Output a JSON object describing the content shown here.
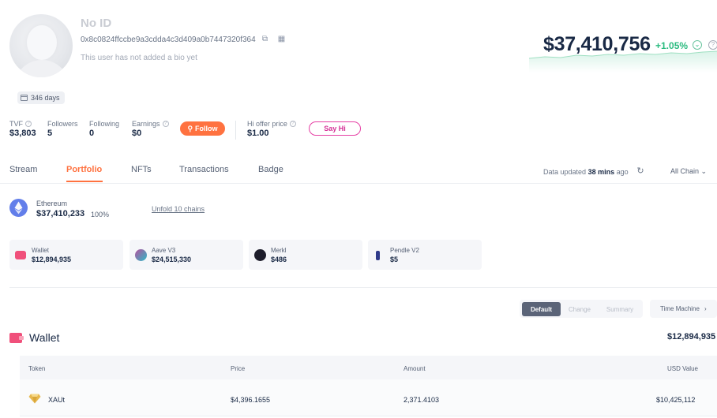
{
  "profile": {
    "name": "No ID",
    "address": "0x8c0824ffccbe9a3cdda4c3d409a0b7447320f364",
    "bio": "This user has not added a bio yet",
    "days": "346 days"
  },
  "net_worth": {
    "value": "$37,410,756",
    "change": "+1.05%",
    "change_chevron": "⌄",
    "help": "?"
  },
  "stats": {
    "tvf_label": "TVF",
    "tvf_value": "$3,803",
    "followers_label": "Followers",
    "followers_value": "5",
    "following_label": "Following",
    "following_value": "0",
    "earnings_label": "Earnings",
    "earnings_value": "$0",
    "follow_button": "Follow",
    "hi_offer_label": "Hi offer price",
    "hi_offer_value": "$1.00",
    "say_hi_button": "Say Hi"
  },
  "tabs": [
    "Stream",
    "Portfolio",
    "NFTs",
    "Transactions",
    "Badge"
  ],
  "active_tab": "Portfolio",
  "toolbar": {
    "data_updated_prefix": "Data updated",
    "data_updated_time": "38 mins",
    "data_updated_suffix": "ago",
    "chain_filter": "All Chain"
  },
  "chain": {
    "name": "Ethereum",
    "value": "$37,410,233",
    "percent": "100%",
    "unfold_link": "Unfold 10 chains"
  },
  "protocols": [
    {
      "name": "Wallet",
      "value": "$12,894,935",
      "icon": "wallet-icon",
      "color": "#f0507b"
    },
    {
      "name": "Aave V3",
      "value": "$24,515,330",
      "icon": "aave-icon",
      "color": "#9b8ee6"
    },
    {
      "name": "Merkl",
      "value": "$486",
      "icon": "merkl-icon",
      "color": "#1d1d2b"
    },
    {
      "name": "Pendle V2",
      "value": "$5",
      "icon": "pendle-icon",
      "color": "#2f3a8a"
    }
  ],
  "view_modes": [
    "Default",
    "Change",
    "Summary"
  ],
  "active_view": "Default",
  "time_machine": "Time Machine",
  "wallet": {
    "title": "Wallet",
    "total": "$12,894,935",
    "columns": [
      "Token",
      "Price",
      "Amount",
      "USD Value"
    ],
    "rows": [
      {
        "token": "XAUt",
        "price": "$4,396.1655",
        "amount": "2,371.4103",
        "usd_value": "$10,425,112"
      }
    ]
  },
  "colors": {
    "accent": "#ff7240",
    "positive": "#2abb7f",
    "say_hi": "#e53fa4",
    "ethereum": "#627eea"
  }
}
